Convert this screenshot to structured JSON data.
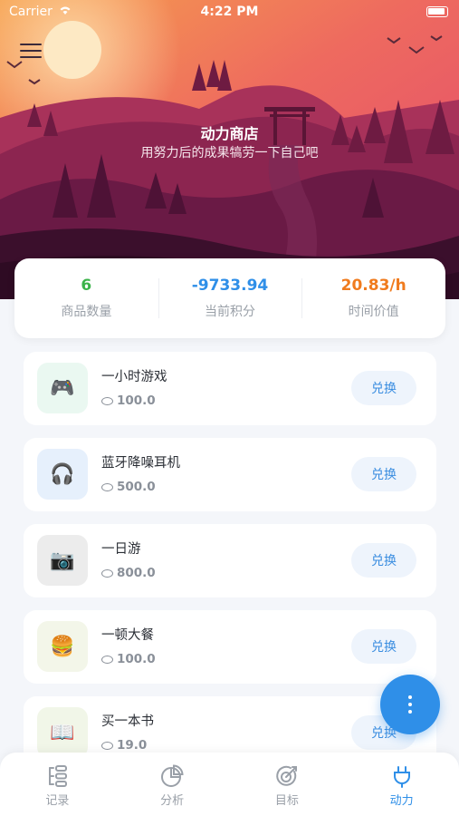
{
  "status_bar": {
    "carrier": "Carrier",
    "time": "4:22 PM"
  },
  "header": {
    "title": "动力商店",
    "subtitle": "用努力后的成果犒劳一下自己吧"
  },
  "stats": [
    {
      "value": "6",
      "label": "商品数量",
      "color": "#3bb34a"
    },
    {
      "value": "-9733.94",
      "label": "当前积分",
      "color": "#2f8fe8"
    },
    {
      "value": "20.83/h",
      "label": "时间价值",
      "color": "#f07b1e"
    }
  ],
  "items": [
    {
      "name": "一小时游戏",
      "price": "100.0",
      "icon": "game-controller-icon",
      "glyph": "🎮",
      "icon_bg": "#eaf8f1",
      "button": "兑换"
    },
    {
      "name": "蓝牙降噪耳机",
      "price": "500.0",
      "icon": "headphones-icon",
      "glyph": "🎧",
      "icon_bg": "#e6f0fc",
      "button": "兑换"
    },
    {
      "name": "一日游",
      "price": "800.0",
      "icon": "camera-icon",
      "glyph": "📷",
      "icon_bg": "#ececec",
      "button": "兑换"
    },
    {
      "name": "一顿大餐",
      "price": "100.0",
      "icon": "burger-icon",
      "glyph": "🍔",
      "icon_bg": "#f3f6e9",
      "button": "兑换"
    },
    {
      "name": "买一本书",
      "price": "19.0",
      "icon": "book-icon",
      "glyph": "📖",
      "icon_bg": "#f1f6e8",
      "button": "兑换"
    }
  ],
  "tabs": [
    {
      "label": "记录",
      "icon": "record-icon"
    },
    {
      "label": "分析",
      "icon": "pie-chart-icon"
    },
    {
      "label": "目标",
      "icon": "target-icon"
    },
    {
      "label": "动力",
      "icon": "plug-icon",
      "active": true
    }
  ],
  "colors": {
    "accent": "#2f8fe8",
    "button_text": "#3a8de0"
  }
}
